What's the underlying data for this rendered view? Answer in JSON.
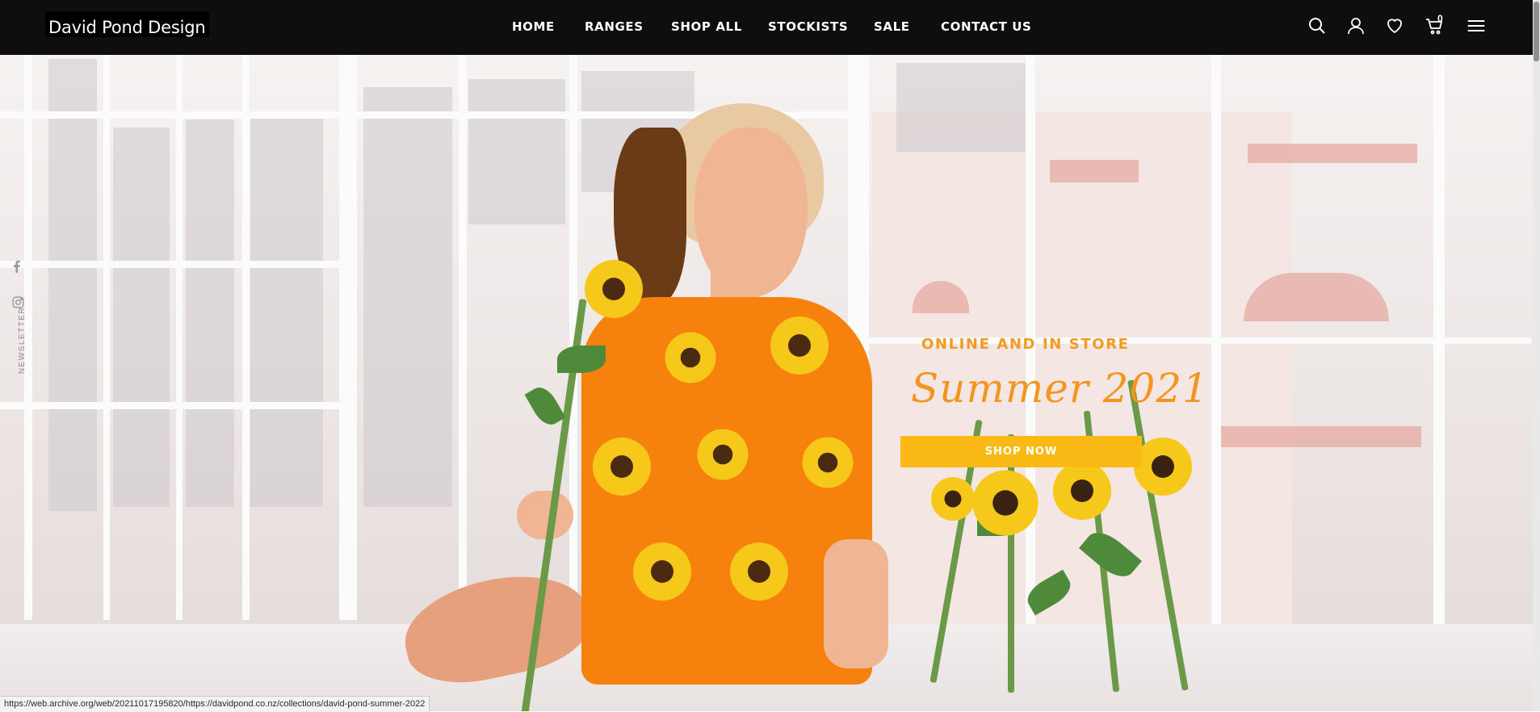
{
  "brand": {
    "logo_text": "David Pond Design"
  },
  "nav": {
    "items": [
      {
        "label": "HOME"
      },
      {
        "label": "RANGES"
      },
      {
        "label": "SHOP ALL"
      },
      {
        "label": "STOCKISTS"
      },
      {
        "label": "SALE"
      },
      {
        "label": "CONTACT US"
      }
    ]
  },
  "header_icons": {
    "search": "search-icon",
    "account": "user-icon",
    "wishlist": "heart-icon",
    "cart": "cart-icon",
    "menu": "hamburger-menu-icon",
    "cart_count": "0"
  },
  "hero": {
    "tagline": "ONLINE AND IN STORE",
    "title": "Summer 2021",
    "button_label": "SHOP NOW",
    "colors": {
      "accent": "#f39a22",
      "button": "#fbb915",
      "dress": "#f7810d"
    }
  },
  "side_rail": {
    "facebook": "facebook-icon",
    "instagram": "instagram-icon",
    "newsletter_label": "NEWSLETTER"
  },
  "status_bar": {
    "url": "https://web.archive.org/web/20211017195820/https://davidpond.co.nz/collections/david-pond-summer-2022"
  }
}
